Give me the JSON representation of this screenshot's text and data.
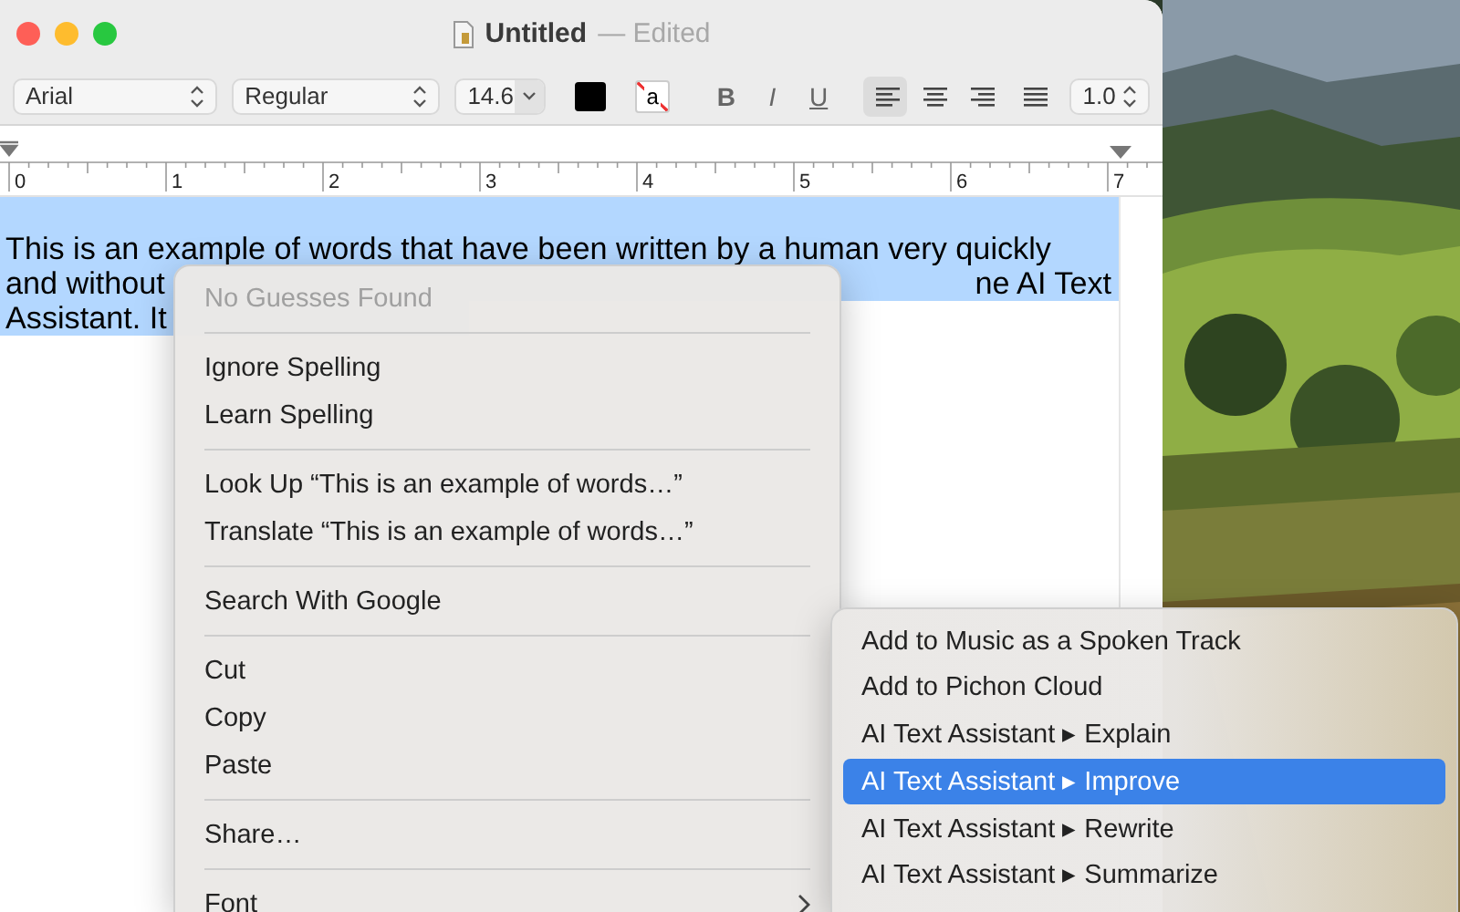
{
  "window": {
    "title": "Untitled",
    "status": "— Edited"
  },
  "toolbar": {
    "font": "Arial",
    "style": "Regular",
    "size": "14.6",
    "highlight_glyph": "a",
    "bold": "B",
    "italic": "I",
    "underline": "U",
    "alignments": [
      {
        "kind": "left",
        "selected": true
      },
      {
        "kind": "center",
        "selected": false
      },
      {
        "kind": "right",
        "selected": false
      },
      {
        "kind": "justify",
        "selected": false
      }
    ],
    "spacing": "1.0"
  },
  "ruler": {
    "labels": [
      "0",
      "1",
      "2",
      "3",
      "4",
      "5",
      "6",
      "7"
    ]
  },
  "document": {
    "lines": [
      {
        "segments": [
          "This is an example of words that have been written by a human very quickly"
        ]
      },
      {
        "segments": [
          "and without",
          "ne AI Text"
        ]
      },
      {
        "segments": [
          "Assistant. It"
        ]
      }
    ]
  },
  "context_menu": {
    "items": [
      {
        "kind": "item",
        "label": "No Guesses Found",
        "disabled": true
      },
      {
        "kind": "separator"
      },
      {
        "kind": "item",
        "label": "Ignore Spelling",
        "disabled": false
      },
      {
        "kind": "item",
        "label": "Learn Spelling",
        "disabled": false
      },
      {
        "kind": "separator"
      },
      {
        "kind": "item",
        "label": "Look Up “This is an example of words…”",
        "disabled": false
      },
      {
        "kind": "item",
        "label": "Translate “This is an example of words…”",
        "disabled": false
      },
      {
        "kind": "separator"
      },
      {
        "kind": "item",
        "label": "Search With Google",
        "disabled": false
      },
      {
        "kind": "separator"
      },
      {
        "kind": "item",
        "label": "Cut",
        "disabled": false
      },
      {
        "kind": "item",
        "label": "Copy",
        "disabled": false
      },
      {
        "kind": "item",
        "label": "Paste",
        "disabled": false
      },
      {
        "kind": "separator"
      },
      {
        "kind": "item",
        "label": "Share…",
        "disabled": false
      },
      {
        "kind": "separator"
      },
      {
        "kind": "submenu",
        "label": "Font",
        "disabled": false
      }
    ]
  },
  "services_menu": {
    "items": [
      {
        "label": "Add to Music as a Spoken Track",
        "selected": false
      },
      {
        "label": "Add to Pichon Cloud",
        "selected": false
      },
      {
        "label": "AI Text Assistant ▸ Explain",
        "selected": false
      },
      {
        "label": "AI Text Assistant ▸ Improve",
        "selected": true
      },
      {
        "label": "AI Text Assistant ▸ Rewrite",
        "selected": false
      },
      {
        "label": "AI Text Assistant ▸ Summarize",
        "selected": false
      }
    ]
  }
}
